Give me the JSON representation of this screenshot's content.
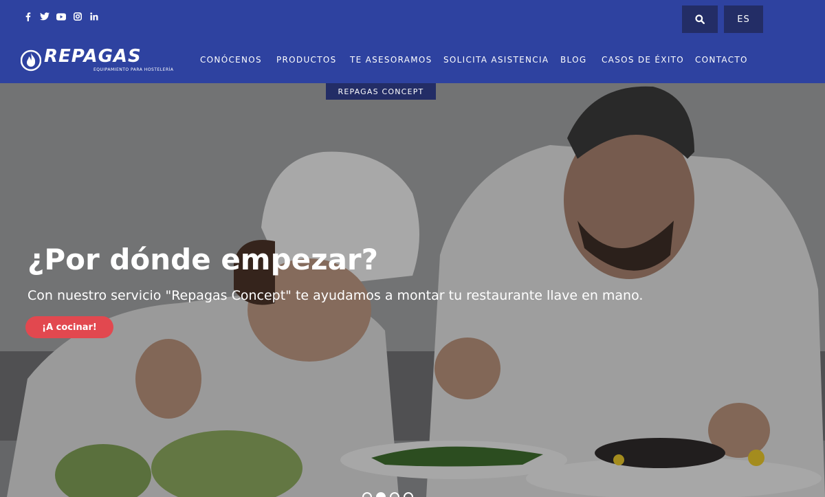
{
  "header": {
    "social": [
      "facebook-icon",
      "twitter-icon",
      "youtube-icon",
      "instagram-icon",
      "linkedin-icon"
    ],
    "lang": "ES",
    "logo": {
      "name": "REPAGAS",
      "tagline": "EQUIPAMIENTO PARA HOSTELERÍA"
    }
  },
  "nav": {
    "items": [
      "CONÓCENOS",
      "PRODUCTOS",
      "TE ASESORAMOS",
      "SOLICITA ASISTENCIA",
      "BLOG",
      "CASOS DE ÉXITO",
      "CONTACTO"
    ],
    "submenu": "REPAGAS CONCEPT"
  },
  "hero": {
    "title": "¿Por dónde empezar?",
    "subtitle": "Con nuestro servicio \"Repagas Concept\" te ayudamos a montar tu restaurante llave en mano.",
    "cta": "¡A cocinar!",
    "slide_count": 4,
    "active_slide": 2
  },
  "colors": {
    "header": "#2e42a0",
    "dark_button": "#232d66",
    "cta": "#e2484f"
  }
}
